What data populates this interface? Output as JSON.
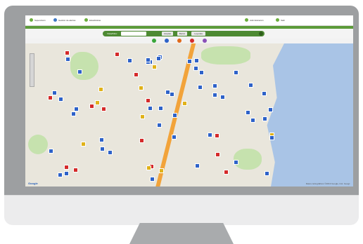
{
  "nav": {
    "items": [
      {
        "label": "Supervisión",
        "icon": "leaf-icon"
      },
      {
        "label": "Gestión de alertas",
        "icon": "globe-icon"
      },
      {
        "label": "Estadísticas",
        "icon": "leaf-icon"
      }
    ],
    "right_items": [
      {
        "label": "Administración",
        "icon": "leaf-icon"
      },
      {
        "label": "Salir",
        "icon": "leaf-icon"
      }
    ]
  },
  "searchbar": {
    "label": "Vista/Filtro:",
    "buttons": [
      "Aceptar",
      "Borrar",
      "Leyenda"
    ]
  },
  "legend": [
    {
      "color": "#3aa63a"
    },
    {
      "color": "#2e62c8"
    },
    {
      "color": "#e06a1a"
    },
    {
      "color": "#d42a2a"
    },
    {
      "color": "#8a4fb8"
    }
  ],
  "map": {
    "provider": "Google",
    "credit": "Datos cartográficos ©2013 Google, Inst. Geogr."
  },
  "colors": {
    "brand_green": "#5c9b3a",
    "sea": "#a9c4e6",
    "land": "#e9e6dc",
    "marker_blue": "#2e62c8"
  }
}
